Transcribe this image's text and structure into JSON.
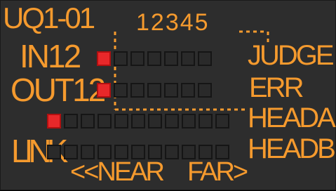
{
  "panel": {
    "title": "UQ1-01",
    "ports_label": "12345",
    "rows": {
      "in": "IN12",
      "out": "OUT12",
      "link": "LINK"
    },
    "right_labels": {
      "judge": "JUDGE",
      "err": "ERR",
      "head_a": "HEADA",
      "head_b": "HEADB"
    },
    "near": "<<NEAR",
    "far": "FAR>"
  },
  "indicators": {
    "lit_color": "#e8282a",
    "off_color": "#2a2a2a",
    "accent_color": "#f59a2e",
    "rows": [
      {
        "name": "in",
        "states": [
          true,
          false,
          false,
          false,
          false,
          false,
          false
        ]
      },
      {
        "name": "out",
        "states": [
          true,
          false,
          false,
          false,
          false,
          false,
          false
        ]
      },
      {
        "name": "head-a",
        "states": [
          true,
          false,
          false,
          false,
          false,
          false,
          false,
          false,
          false,
          false,
          false
        ]
      },
      {
        "name": "link",
        "states": [
          false,
          false,
          false,
          false,
          false,
          false,
          false,
          false,
          false,
          false,
          false
        ]
      }
    ]
  }
}
